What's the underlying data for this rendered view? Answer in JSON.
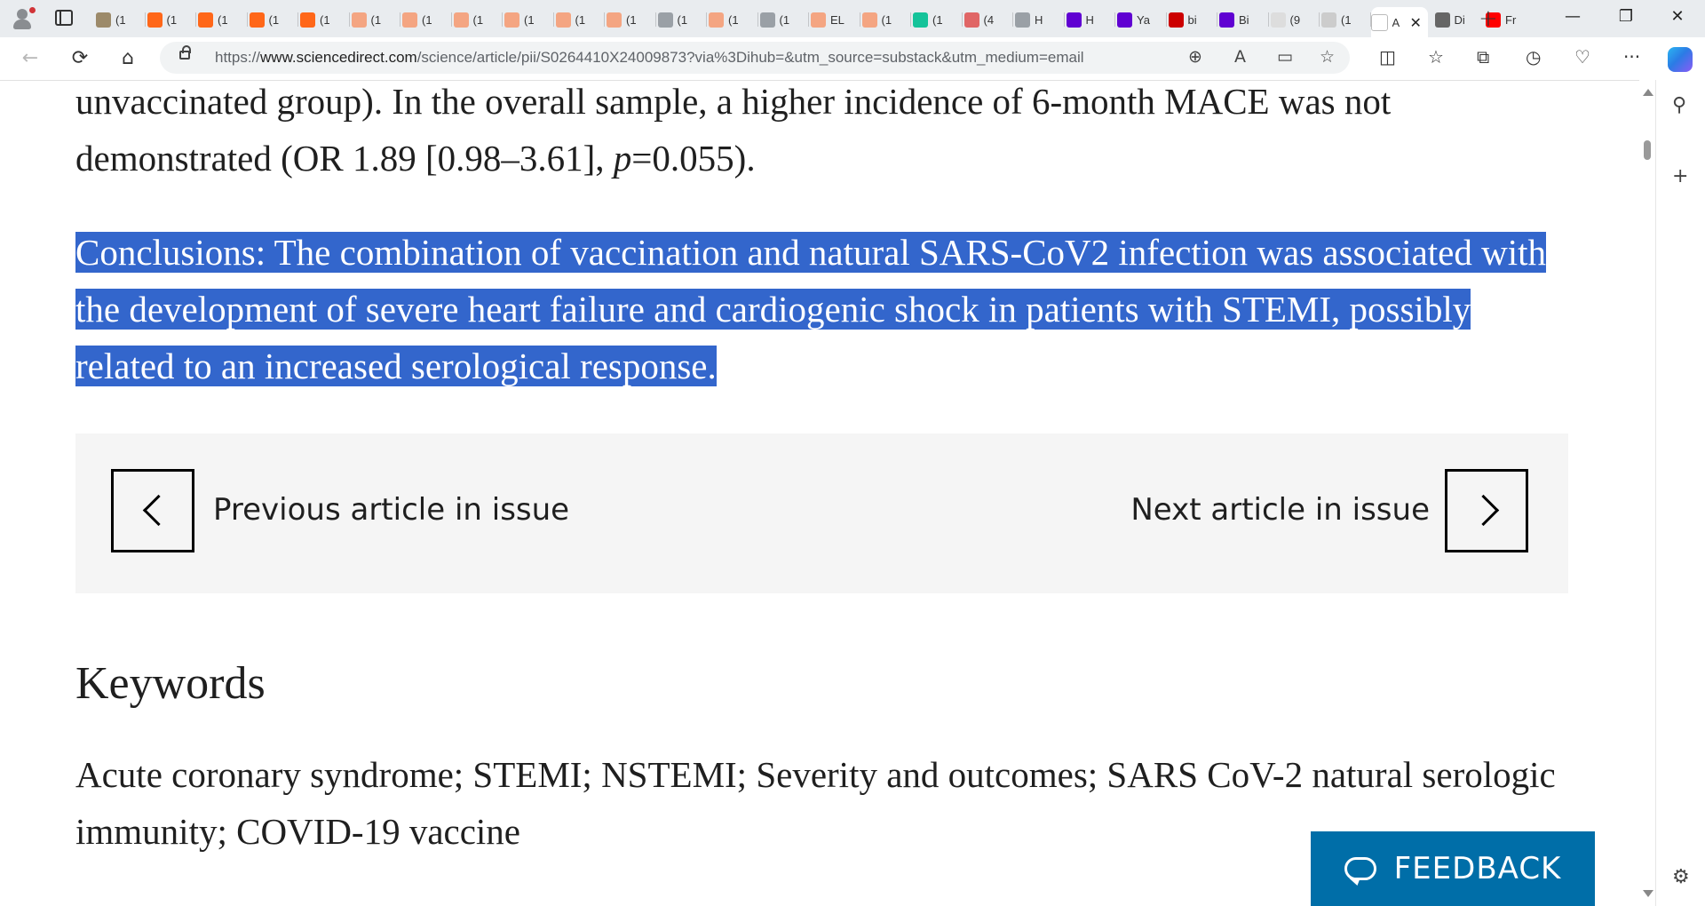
{
  "browser": {
    "tabs": [
      {
        "title": "(1",
        "icon": "image-favicon",
        "color": "#9c8a6a"
      },
      {
        "title": "(1",
        "icon": "substack-favicon",
        "color": "#ff6719"
      },
      {
        "title": "(1",
        "icon": "substack-favicon",
        "color": "#ff6719"
      },
      {
        "title": "(1",
        "icon": "substack-favicon",
        "color": "#ff6719"
      },
      {
        "title": "(1",
        "icon": "substack-favicon",
        "color": "#ff6719"
      },
      {
        "title": "(1",
        "icon": "substack-favicon",
        "color": "#f4a582"
      },
      {
        "title": "(1",
        "icon": "substack-favicon",
        "color": "#f4a582"
      },
      {
        "title": "(1",
        "icon": "substack-favicon",
        "color": "#f4a582"
      },
      {
        "title": "(1",
        "icon": "substack-favicon",
        "color": "#f4a582"
      },
      {
        "title": "(1",
        "icon": "substack-favicon",
        "color": "#f4a582"
      },
      {
        "title": "(1",
        "icon": "substack-favicon",
        "color": "#f4a582"
      },
      {
        "title": "(1",
        "icon": "page-favicon",
        "color": "#9aa0a6"
      },
      {
        "title": "(1",
        "icon": "substack-favicon",
        "color": "#f4a582"
      },
      {
        "title": "(1",
        "icon": "page-favicon",
        "color": "#9aa0a6"
      },
      {
        "title": "EL",
        "icon": "substack-favicon",
        "color": "#f4a582"
      },
      {
        "title": "(1",
        "icon": "substack-favicon",
        "color": "#f4a582"
      },
      {
        "title": "(1",
        "icon": "grammarly-favicon",
        "color": "#15c39a"
      },
      {
        "title": "(4",
        "icon": "red-favicon",
        "color": "#e06666"
      },
      {
        "title": "H",
        "icon": "page-favicon",
        "color": "#9aa0a6"
      },
      {
        "title": "H",
        "icon": "yahoo-favicon",
        "color": "#6001d2"
      },
      {
        "title": "Ya",
        "icon": "yahoo-favicon",
        "color": "#6001d2"
      },
      {
        "title": "bi",
        "icon": "cnn-favicon",
        "color": "#cc0000"
      },
      {
        "title": "Bi",
        "icon": "mail-favicon",
        "color": "#6001d2"
      },
      {
        "title": "(9",
        "icon": "blank-favicon",
        "color": "#dddddd"
      },
      {
        "title": "(1",
        "icon": "blank-favicon",
        "color": "#cccccc"
      }
    ],
    "active_tab": {
      "title": "A",
      "close": "✕"
    },
    "after_tabs": [
      {
        "title": "Di",
        "icon": "stripes-favicon",
        "color": "#666666"
      },
      {
        "title": "Fr",
        "icon": "youtube-favicon",
        "color": "#ff0000"
      }
    ],
    "new_tab": "+",
    "window": {
      "minimize": "—",
      "restore": "❐",
      "close": "✕"
    },
    "url": {
      "prefix": "https://",
      "host": "www.sciencedirect.com",
      "path": "/science/article/pii/S0264410X24009873?via%3Dihub=&utm_source=substack&utm_medium=email"
    },
    "icons": {
      "back": "←",
      "refresh": "⟳",
      "home": "⌂",
      "zoom": "⊕",
      "read_aloud": "A",
      "immersive": "▭",
      "favorite": "☆",
      "split": "◫",
      "favorites": "☆",
      "collections": "⧉",
      "history": "◷",
      "health": "♡",
      "more": "···",
      "search_side": "⚲",
      "add_side": "+",
      "settings_side": "⚙"
    }
  },
  "article": {
    "para1": "unvaccinated group). In the overall sample, a higher incidence of 6-month MACE was not demonstrated (OR 1.89 [0.98–3.61], ",
    "para1_p": "p",
    "para1_end": "=0.055).",
    "conclusions": "Conclusions: The combination of vaccination and natural SARS-CoV2 infection was associated with the development of severe heart failure and cardiogenic shock in patients with STEMI, possibly related to an increased serological response.",
    "prev_label": "Previous article in issue",
    "next_label": "Next article in issue",
    "keywords_title": "Keywords",
    "keywords": "Acute coronary syndrome; STEMI; NSTEMI; Severity and outcomes; SARS CoV-2 natural serologic immunity; COVID-19 vaccine",
    "feedback": "FEEDBACK"
  },
  "colors": {
    "selection": "#3366cc",
    "feedback": "#006ea8",
    "nav_box": "#f5f5f5"
  }
}
